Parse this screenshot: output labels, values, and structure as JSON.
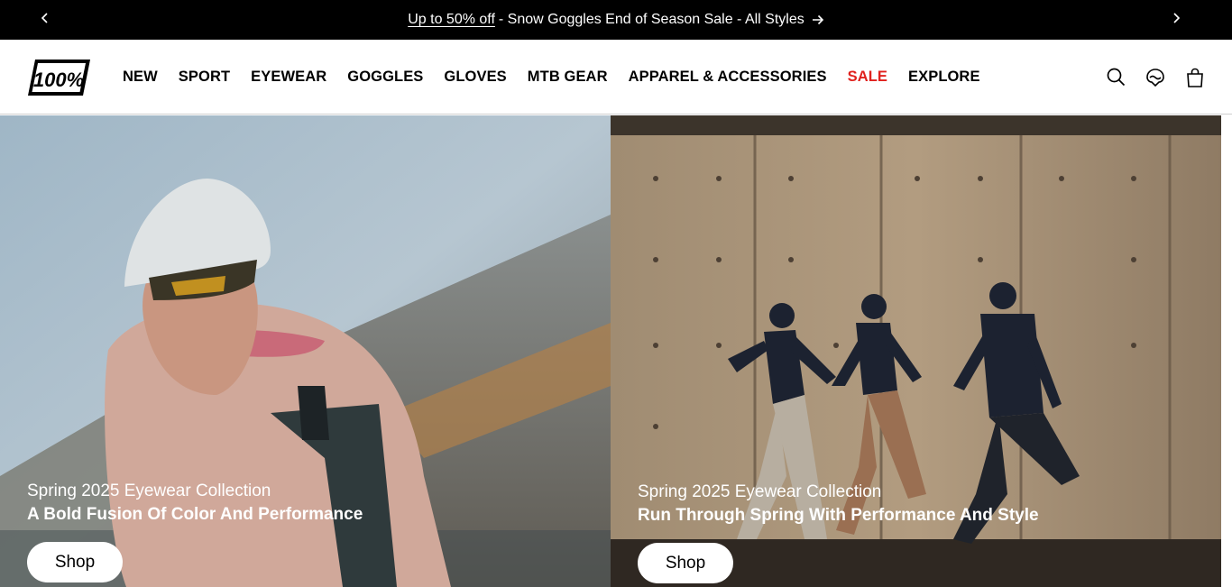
{
  "announcement": {
    "link_text": "Up to 50% off",
    "rest_text": "- Snow Goggles End of Season Sale - All Styles",
    "prev_icon": "chevron-left-icon",
    "next_icon": "chevron-right-icon",
    "arrow_icon": "arrow-right-icon"
  },
  "header": {
    "logo_text": "100%",
    "nav": [
      {
        "label": "NEW"
      },
      {
        "label": "SPORT"
      },
      {
        "label": "EYEWEAR"
      },
      {
        "label": "GOGGLES"
      },
      {
        "label": "GLOVES"
      },
      {
        "label": "MTB GEAR"
      },
      {
        "label": "APPAREL & ACCESSORIES"
      },
      {
        "label": "SALE"
      },
      {
        "label": "EXPLORE"
      }
    ],
    "sale_color": "#e0211d",
    "icons": [
      "search-icon",
      "support-icon",
      "bag-icon"
    ]
  },
  "hero": {
    "left": {
      "eyebrow": "Spring 2025 Eyewear Collection",
      "headline": "A Bold Fusion Of Color And Performance",
      "button": "Shop"
    },
    "right": {
      "eyebrow": "Spring 2025 Eyewear Collection",
      "headline": "Run Through Spring With Performance And Style",
      "button": "Shop"
    }
  }
}
